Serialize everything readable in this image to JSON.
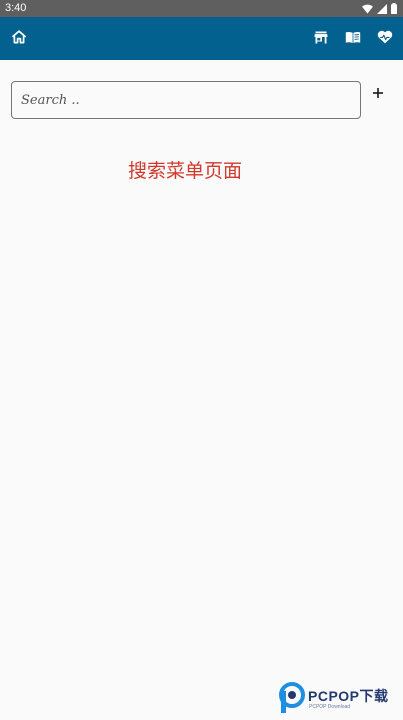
{
  "status_bar": {
    "time": "3:40",
    "icons": [
      "wifi-icon",
      "signal-icon",
      "battery-icon"
    ]
  },
  "app_bar": {
    "background": "#02618f",
    "left_icon": "home-icon",
    "right_icons": [
      "store-icon",
      "book-icon",
      "heart-icon"
    ]
  },
  "search": {
    "placeholder": "Search ..",
    "value": ""
  },
  "add_button": {
    "label": "+"
  },
  "main": {
    "heading": "搜索菜单页面",
    "heading_color": "#d0392b"
  },
  "watermark": {
    "text": "PCPOP下载",
    "subtext": "PCPOP Download"
  }
}
